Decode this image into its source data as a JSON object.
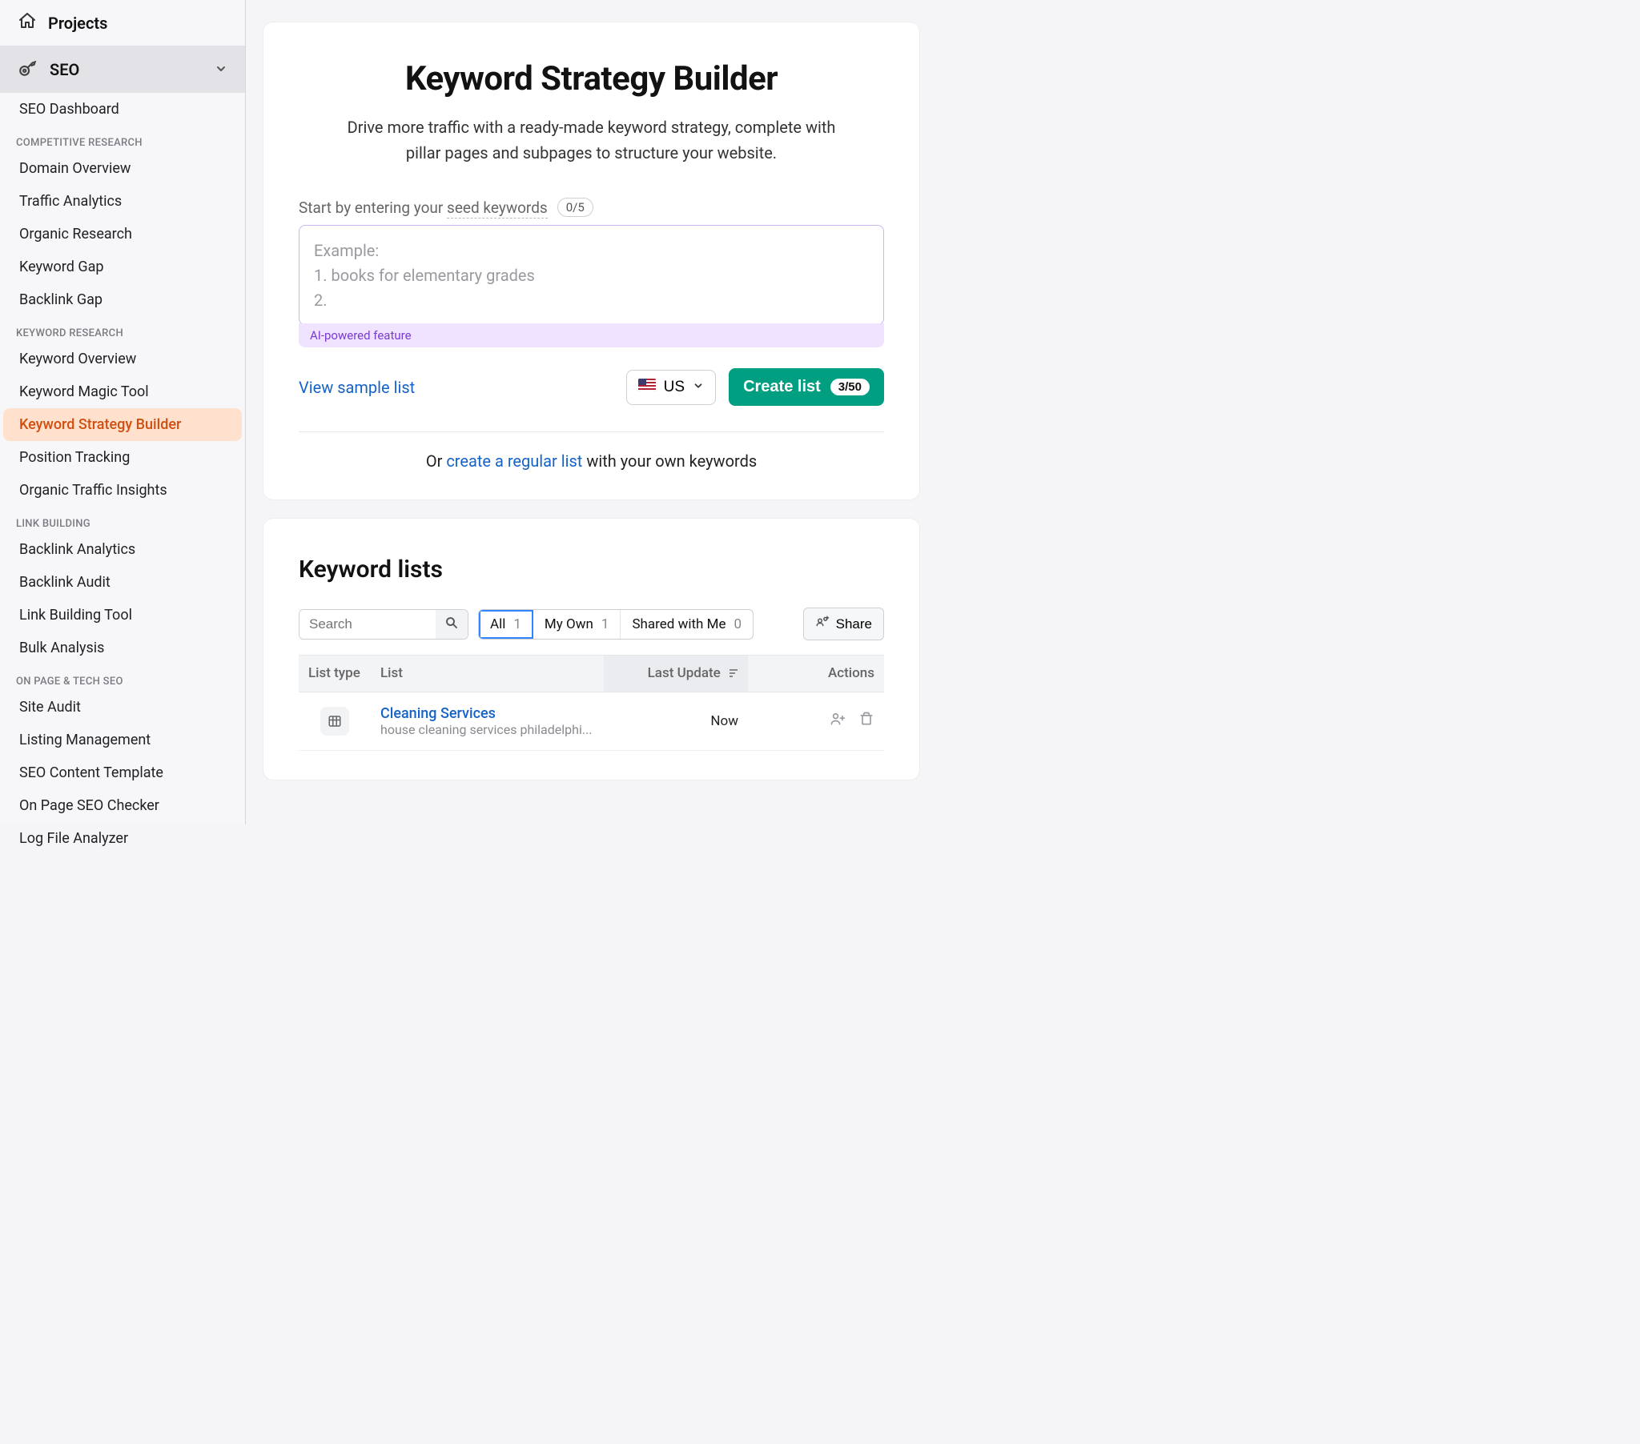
{
  "sidebar": {
    "projects_label": "Projects",
    "seo_label": "SEO",
    "groups": [
      {
        "items": [
          {
            "label": "SEO Dashboard",
            "key": "seo-dashboard"
          }
        ]
      },
      {
        "heading": "COMPETITIVE RESEARCH",
        "items": [
          {
            "label": "Domain Overview",
            "key": "domain-overview"
          },
          {
            "label": "Traffic Analytics",
            "key": "traffic-analytics"
          },
          {
            "label": "Organic Research",
            "key": "organic-research"
          },
          {
            "label": "Keyword Gap",
            "key": "keyword-gap"
          },
          {
            "label": "Backlink Gap",
            "key": "backlink-gap"
          }
        ]
      },
      {
        "heading": "KEYWORD RESEARCH",
        "items": [
          {
            "label": "Keyword Overview",
            "key": "keyword-overview"
          },
          {
            "label": "Keyword Magic Tool",
            "key": "keyword-magic-tool"
          },
          {
            "label": "Keyword Strategy Builder",
            "key": "keyword-strategy-builder",
            "active": true
          },
          {
            "label": "Position Tracking",
            "key": "position-tracking"
          },
          {
            "label": "Organic Traffic Insights",
            "key": "organic-traffic-insights"
          }
        ]
      },
      {
        "heading": "LINK BUILDING",
        "items": [
          {
            "label": "Backlink Analytics",
            "key": "backlink-analytics"
          },
          {
            "label": "Backlink Audit",
            "key": "backlink-audit"
          },
          {
            "label": "Link Building Tool",
            "key": "link-building-tool"
          },
          {
            "label": "Bulk Analysis",
            "key": "bulk-analysis"
          }
        ]
      },
      {
        "heading": "ON PAGE & TECH SEO",
        "items": [
          {
            "label": "Site Audit",
            "key": "site-audit"
          },
          {
            "label": "Listing Management",
            "key": "listing-management"
          },
          {
            "label": "SEO Content Template",
            "key": "seo-content-template"
          },
          {
            "label": "On Page SEO Checker",
            "key": "on-page-seo-checker"
          },
          {
            "label": "Log File Analyzer",
            "key": "log-file-analyzer"
          }
        ]
      }
    ]
  },
  "builder": {
    "title": "Keyword Strategy Builder",
    "subtitle": "Drive more traffic with a ready-made keyword strategy, complete with pillar pages and subpages to structure your website.",
    "seed_label_pre": "Start by entering your ",
    "seed_label_link": "seed keywords",
    "seed_count": "0/5",
    "seed_placeholder": "Example:\n1.    books for elementary grades\n2.",
    "ai_tag": "AI-powered feature",
    "view_sample": "View sample list",
    "country_code": "US",
    "create_label": "Create list",
    "create_badge": "3/50",
    "or_pre": "Or ",
    "or_link": "create a regular list",
    "or_post": " with your own keywords"
  },
  "lists": {
    "title": "Keyword lists",
    "search_placeholder": "Search",
    "tabs": [
      {
        "label": "All",
        "count": 1,
        "key": "all",
        "active": true
      },
      {
        "label": "My Own",
        "count": 1,
        "key": "my-own"
      },
      {
        "label": "Shared with Me",
        "count": 0,
        "key": "shared"
      }
    ],
    "share_label": "Share",
    "columns": {
      "type": "List type",
      "list": "List",
      "last_update": "Last Update",
      "actions": "Actions"
    },
    "rows": [
      {
        "name": "Cleaning Services",
        "sub": "house cleaning services philadelphi...",
        "last_update": "Now"
      }
    ]
  }
}
